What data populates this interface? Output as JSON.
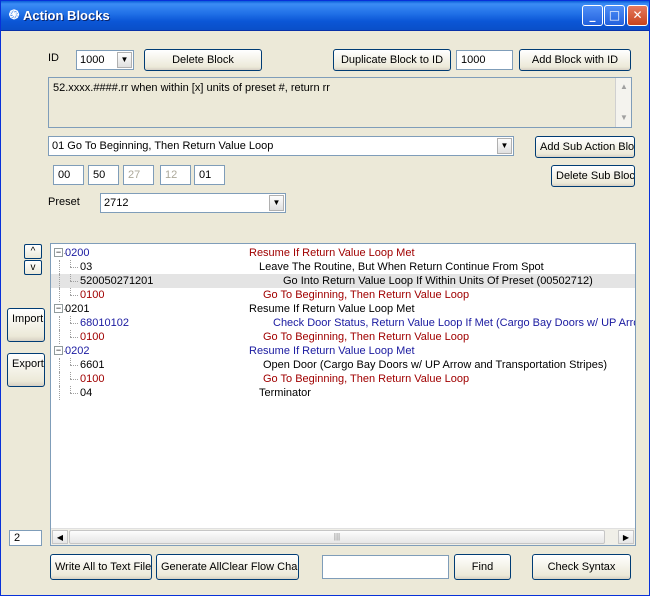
{
  "window": {
    "title": "Action Blocks"
  },
  "top": {
    "id_label": "ID",
    "id_value": "1000",
    "delete_block": "Delete Block",
    "duplicate_block": "Duplicate Block to ID",
    "duplicate_id": "1000",
    "add_block": "Add Block with ID"
  },
  "description": "52.xxxx.####.rr when within [x] units of preset #, return rr",
  "action_select": "01 Go To Beginning, Then Return Value Loop",
  "add_sub_block": "Add Sub Action Block",
  "delete_sub_block": "Delete Sub Block",
  "fields": [
    "00",
    "50",
    "27",
    "12",
    "01"
  ],
  "preset": {
    "label": "Preset",
    "value": "2712"
  },
  "updown": {
    "up": "^",
    "down": "v"
  },
  "import_block": "Import Block",
  "export_block": "Export Block",
  "tree": [
    {
      "code": "0200",
      "desc": "Resume If Return Value Loop Met",
      "level": 0,
      "code_color": "blue",
      "desc_color": "red"
    },
    {
      "code": "03",
      "desc": "Leave The Routine, But When Return Continue From Spot",
      "level": 1,
      "code_color": "black",
      "desc_color": "black"
    },
    {
      "code": "520050271201",
      "desc": "Go Into Return Value Loop If Within Units Of Preset (00502712)",
      "level": 1,
      "code_color": "black",
      "desc_color": "black",
      "selected": true
    },
    {
      "code": "0100",
      "desc": "Go To Beginning, Then Return Value Loop",
      "level": 1,
      "code_color": "red",
      "desc_color": "red"
    },
    {
      "code": "0201",
      "desc": "Resume If Return Value Loop Met",
      "level": 0,
      "code_color": "black",
      "desc_color": "black"
    },
    {
      "code": "68010102",
      "desc": "Check Door Status, Return Value Loop If Met (Cargo Bay Doors w/ UP Arrow and T",
      "level": 1,
      "code_color": "blue",
      "desc_color": "blue"
    },
    {
      "code": "0100",
      "desc": "Go To Beginning, Then Return Value Loop",
      "level": 1,
      "code_color": "red",
      "desc_color": "red"
    },
    {
      "code": "0202",
      "desc": "Resume If Return Value Loop Met",
      "level": 0,
      "code_color": "blue",
      "desc_color": "blue"
    },
    {
      "code": "6601",
      "desc": "Open Door (Cargo Bay Doors w/ UP Arrow and Transportation Stripes)",
      "level": 1,
      "code_color": "black",
      "desc_color": "black"
    },
    {
      "code": "0100",
      "desc": "Go To Beginning, Then Return Value Loop",
      "level": 1,
      "code_color": "red",
      "desc_color": "red"
    },
    {
      "code": "04",
      "desc": "Terminator",
      "level": 1,
      "code_color": "black",
      "desc_color": "black"
    }
  ],
  "status_count": "2",
  "bottom": {
    "write_all": "Write All to Text File",
    "generate_charts": "Generate AllClear Flow Charts",
    "find_value": "",
    "find": "Find",
    "check_syntax": "Check Syntax"
  }
}
